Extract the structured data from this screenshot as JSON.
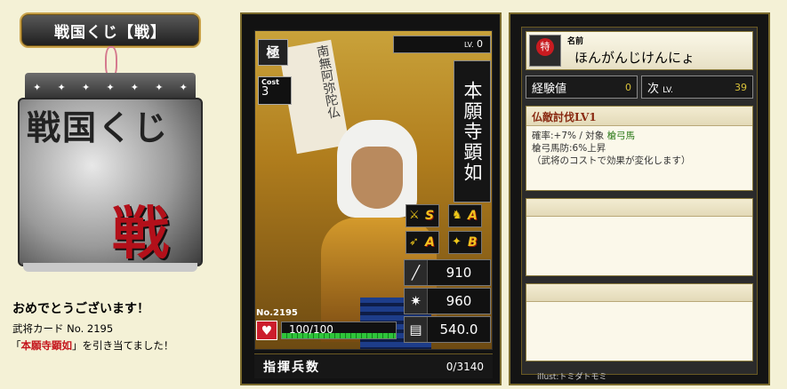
{
  "header": {
    "title": "戦国くじ【戦】"
  },
  "calendar": {
    "ink_top": "戦国くじ",
    "ink_big": "戦",
    "dots": [
      "✦",
      "✦",
      "✦",
      "✦",
      "✦",
      "✦",
      "✦"
    ]
  },
  "message": {
    "congrats": "おめでとうございます！",
    "card_no_line": "武将カード No. 2195",
    "result_prefix": "「",
    "result_name": "本願寺顕如",
    "result_suffix": "」を引き当てました！"
  },
  "card": {
    "rank": "極",
    "cost_label": "Cost",
    "cost": "3",
    "level_label": "LV.",
    "level": "0",
    "name": "本願寺顕如",
    "scroll_text": "南無阿弥陀仏",
    "skills": [
      {
        "icon": "spear-icon",
        "glyph": "⚔",
        "grade": "S"
      },
      {
        "icon": "horse-icon",
        "glyph": "♞",
        "grade": "A"
      },
      {
        "icon": "bow-icon",
        "glyph": "➶",
        "grade": "A"
      },
      {
        "icon": "cannon-icon",
        "glyph": "✦",
        "grade": "B"
      }
    ],
    "stats": [
      {
        "icon": "attack-icon",
        "glyph": "╱",
        "value": "910"
      },
      {
        "icon": "defense-icon",
        "glyph": "✷",
        "value": "960"
      },
      {
        "icon": "intelligence-icon",
        "glyph": "▤",
        "value": "540.0"
      }
    ],
    "number_label": "No.",
    "number": "2195",
    "hp_text": "100/100",
    "hp_fraction": 1.0,
    "troop_label": "指揮兵数",
    "troop_count": "0/3140"
  },
  "detail": {
    "name_label": "名前",
    "name_value": "ほんがんじけんにょ",
    "badge_text": "特",
    "exp_label": "経験値",
    "exp_value": "0",
    "next_label": "次",
    "next_lv_label": "LV.",
    "next_value": "39",
    "skill_title": "仏敵討伐LV1",
    "skill_line1_prefix": "確率:+7%  /  対象",
    "skill_line1_target": "槍弓馬",
    "skill_line2": "槍弓馬防:6%上昇",
    "skill_line3": "（武将のコストで効果が変化します）",
    "illust": "illust:トミダトモミ"
  }
}
